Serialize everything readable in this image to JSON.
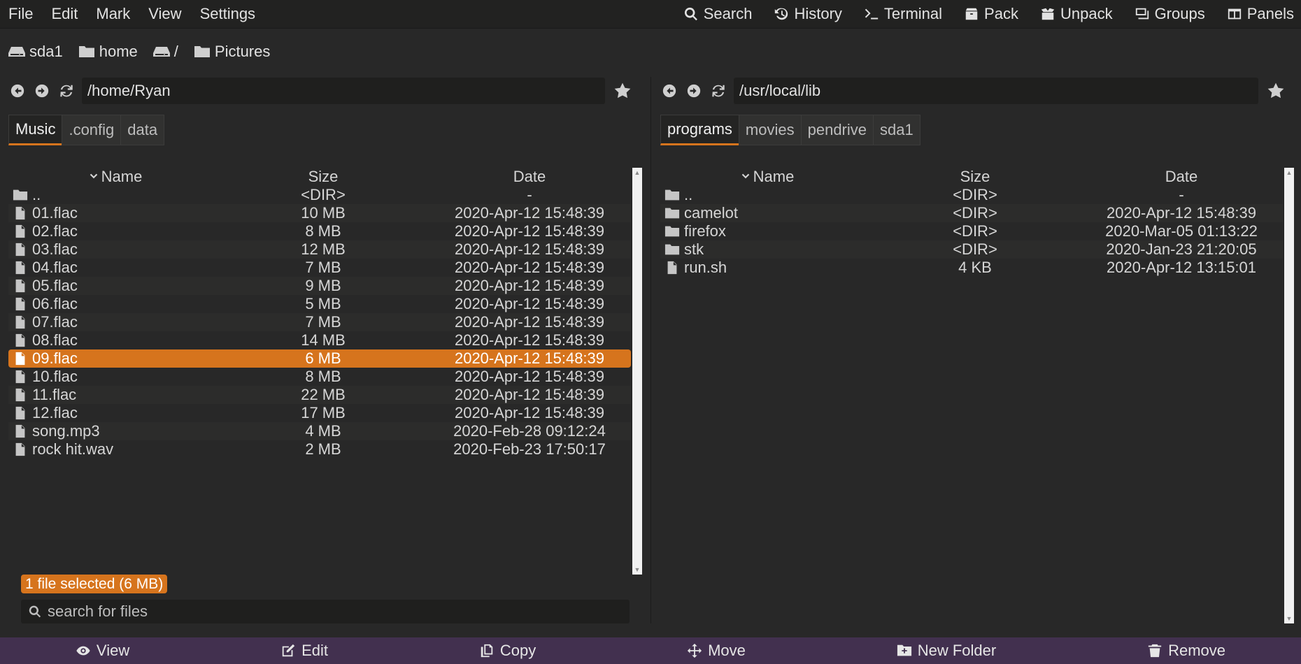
{
  "menu": {
    "left": [
      "File",
      "Edit",
      "Mark",
      "View",
      "Settings"
    ],
    "right": [
      {
        "label": "Search",
        "icon": "search-icon"
      },
      {
        "label": "History",
        "icon": "history-icon"
      },
      {
        "label": "Terminal",
        "icon": "terminal-icon"
      },
      {
        "label": "Pack",
        "icon": "pack-icon"
      },
      {
        "label": "Unpack",
        "icon": "unpack-icon"
      },
      {
        "label": "Groups",
        "icon": "groups-icon"
      },
      {
        "label": "Panels",
        "icon": "panels-icon"
      }
    ]
  },
  "devices": [
    {
      "label": "sda1",
      "icon": "drive-icon"
    },
    {
      "label": "home",
      "icon": "folder-icon"
    },
    {
      "label": "/",
      "icon": "drive-icon"
    },
    {
      "label": "Pictures",
      "icon": "folder-icon"
    }
  ],
  "left_panel": {
    "path": "/home/Ryan",
    "tabs": [
      "Music",
      ".config",
      "data"
    ],
    "active_tab": 0,
    "columns": {
      "name": "Name",
      "size": "Size",
      "date": "Date"
    },
    "rows": [
      {
        "name": "..",
        "size": "<DIR>",
        "date": "-",
        "type": "folder"
      },
      {
        "name": "01.flac",
        "size": "10 MB",
        "date": "2020-Apr-12 15:48:39",
        "type": "file"
      },
      {
        "name": "02.flac",
        "size": "8 MB",
        "date": "2020-Apr-12 15:48:39",
        "type": "file"
      },
      {
        "name": "03.flac",
        "size": "12 MB",
        "date": "2020-Apr-12 15:48:39",
        "type": "file"
      },
      {
        "name": "04.flac",
        "size": "7 MB",
        "date": "2020-Apr-12 15:48:39",
        "type": "file"
      },
      {
        "name": "05.flac",
        "size": "9 MB",
        "date": "2020-Apr-12 15:48:39",
        "type": "file"
      },
      {
        "name": "06.flac",
        "size": "5 MB",
        "date": "2020-Apr-12 15:48:39",
        "type": "file"
      },
      {
        "name": "07.flac",
        "size": "7 MB",
        "date": "2020-Apr-12 15:48:39",
        "type": "file"
      },
      {
        "name": "08.flac",
        "size": "14 MB",
        "date": "2020-Apr-12 15:48:39",
        "type": "file"
      },
      {
        "name": "09.flac",
        "size": "6 MB",
        "date": "2020-Apr-12 15:48:39",
        "type": "file",
        "selected": true
      },
      {
        "name": "10.flac",
        "size": "8 MB",
        "date": "2020-Apr-12 15:48:39",
        "type": "file"
      },
      {
        "name": "11.flac",
        "size": "22 MB",
        "date": "2020-Apr-12 15:48:39",
        "type": "file"
      },
      {
        "name": "12.flac",
        "size": "17 MB",
        "date": "2020-Apr-12 15:48:39",
        "type": "file"
      },
      {
        "name": "song.mp3",
        "size": "4 MB",
        "date": "2020-Feb-28 09:12:24",
        "type": "file"
      },
      {
        "name": "rock hit.wav",
        "size": "2 MB",
        "date": "2020-Feb-23 17:50:17",
        "type": "file"
      }
    ],
    "selection_status": "1 file selected (6 MB)",
    "search_placeholder": "search for files"
  },
  "right_panel": {
    "path": "/usr/local/lib",
    "tabs": [
      "programs",
      "movies",
      "pendrive",
      "sda1"
    ],
    "active_tab": 0,
    "columns": {
      "name": "Name",
      "size": "Size",
      "date": "Date"
    },
    "rows": [
      {
        "name": "..",
        "size": "<DIR>",
        "date": "-",
        "type": "folder"
      },
      {
        "name": "camelot",
        "size": "<DIR>",
        "date": "2020-Apr-12 15:48:39",
        "type": "folder"
      },
      {
        "name": "firefox",
        "size": "<DIR>",
        "date": "2020-Mar-05 01:13:22",
        "type": "folder"
      },
      {
        "name": "stk",
        "size": "<DIR>",
        "date": "2020-Jan-23 21:20:05",
        "type": "folder"
      },
      {
        "name": "run.sh",
        "size": "4 KB",
        "date": "2020-Apr-12 13:15:01",
        "type": "file"
      }
    ]
  },
  "bottom_actions": [
    {
      "label": "View",
      "icon": "eye-icon"
    },
    {
      "label": "Edit",
      "icon": "edit-icon"
    },
    {
      "label": "Copy",
      "icon": "copy-icon"
    },
    {
      "label": "Move",
      "icon": "move-icon"
    },
    {
      "label": "New Folder",
      "icon": "new-folder-icon"
    },
    {
      "label": "Remove",
      "icon": "trash-icon"
    }
  ],
  "colors": {
    "background": "#282828",
    "menubar": "#222221",
    "accent": "#d6741d",
    "bottombar": "#42304f"
  }
}
